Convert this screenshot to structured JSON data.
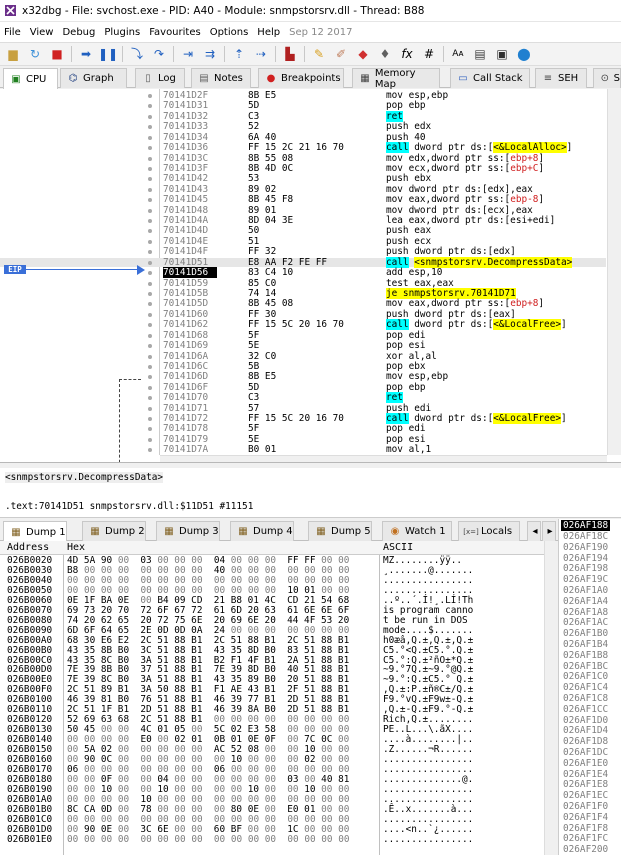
{
  "titlebar": {
    "title": "x32dbg - File: svchost.exe - PID: A40 - Module: snmpstorsrv.dll - Thread: B88"
  },
  "menubar": {
    "items": [
      "File",
      "View",
      "Debug",
      "Plugins",
      "Favourites",
      "Options",
      "Help"
    ],
    "date": "Sep 12 2017"
  },
  "tabs": [
    {
      "label": "CPU",
      "icon": "cpu-icon"
    },
    {
      "label": "Graph",
      "icon": "graph-icon"
    },
    {
      "label": "Log",
      "icon": "log-icon"
    },
    {
      "label": "Notes",
      "icon": "notes-icon"
    },
    {
      "label": "Breakpoints",
      "icon": "breakpoint-icon"
    },
    {
      "label": "Memory Map",
      "icon": "memory-map-icon"
    },
    {
      "label": "Call Stack",
      "icon": "call-stack-icon"
    },
    {
      "label": "SEH",
      "icon": "seh-icon"
    },
    {
      "label": "S",
      "icon": "script-icon"
    }
  ],
  "eip_label": "EIP",
  "disasm": [
    {
      "a": "70141D2F",
      "b": "8B E5",
      "i": "mov esp,ebp"
    },
    {
      "a": "70141D31",
      "b": "5D",
      "i": "pop ebp"
    },
    {
      "a": "70141D32",
      "b": "C3",
      "i": "ret",
      "t": "ret"
    },
    {
      "a": "70141D33",
      "b": "52",
      "i": "push edx"
    },
    {
      "a": "70141D34",
      "b": "6A 40",
      "i": "push 40"
    },
    {
      "a": "70141D36",
      "b": "FF 15 2C 21 16 70",
      "i": "call dword ptr ds:[<&LocalAlloc>]",
      "t": "call"
    },
    {
      "a": "70141D3C",
      "b": "8B 55 08",
      "i": "mov edx,dword ptr ss:[ebp+8]"
    },
    {
      "a": "70141D3F",
      "b": "8B 4D 0C",
      "i": "mov ecx,dword ptr ss:[ebp+C]"
    },
    {
      "a": "70141D42",
      "b": "53",
      "i": "push ebx"
    },
    {
      "a": "70141D43",
      "b": "89 02",
      "i": "mov dword ptr ds:[edx],eax"
    },
    {
      "a": "70141D45",
      "b": "8B 45 F8",
      "i": "mov eax,dword ptr ss:[ebp-8]"
    },
    {
      "a": "70141D48",
      "b": "89 01",
      "i": "mov dword ptr ds:[ecx],eax"
    },
    {
      "a": "70141D4A",
      "b": "8D 04 3E",
      "i": "lea eax,dword ptr ds:[esi+edi]"
    },
    {
      "a": "70141D4D",
      "b": "50",
      "i": "push eax"
    },
    {
      "a": "70141D4E",
      "b": "51",
      "i": "push ecx"
    },
    {
      "a": "70141D4F",
      "b": "FF 32",
      "i": "push dword ptr ds:[edx]"
    },
    {
      "a": "70141D51",
      "b": "E8 AA F2 FE FF",
      "i": "call <snmpstorsrv.DecompressData>",
      "t": "call",
      "hl": true
    },
    {
      "a": "70141D56",
      "b": "83 C4 10",
      "i": "add esp,10",
      "cur": true
    },
    {
      "a": "70141D59",
      "b": "85 C0",
      "i": "test eax,eax"
    },
    {
      "a": "70141D5B",
      "b": "74 14",
      "i": "je snmpstorsrv.70141D71",
      "t": "jmp"
    },
    {
      "a": "70141D5D",
      "b": "8B 45 08",
      "i": "mov eax,dword ptr ss:[ebp+8]"
    },
    {
      "a": "70141D60",
      "b": "FF 30",
      "i": "push dword ptr ds:[eax]"
    },
    {
      "a": "70141D62",
      "b": "FF 15 5C 20 16 70",
      "i": "call dword ptr ds:[<&LocalFree>]",
      "t": "call"
    },
    {
      "a": "70141D68",
      "b": "5F",
      "i": "pop edi"
    },
    {
      "a": "70141D69",
      "b": "5E",
      "i": "pop esi"
    },
    {
      "a": "70141D6A",
      "b": "32 C0",
      "i": "xor al,al"
    },
    {
      "a": "70141D6C",
      "b": "5B",
      "i": "pop ebx"
    },
    {
      "a": "70141D6D",
      "b": "8B E5",
      "i": "mov esp,ebp"
    },
    {
      "a": "70141D6F",
      "b": "5D",
      "i": "pop ebp"
    },
    {
      "a": "70141D70",
      "b": "C3",
      "i": "ret",
      "t": "ret"
    },
    {
      "a": "70141D71",
      "b": "57",
      "i": "push edi"
    },
    {
      "a": "70141D72",
      "b": "FF 15 5C 20 16 70",
      "i": "call dword ptr ds:[<&LocalFree>]",
      "t": "call"
    },
    {
      "a": "70141D78",
      "b": "5F",
      "i": "pop edi"
    },
    {
      "a": "70141D79",
      "b": "5E",
      "i": "pop esi"
    },
    {
      "a": "70141D7A",
      "b": "B0 01",
      "i": "mov al,1"
    }
  ],
  "info": {
    "line1": "<snmpstorsrv.DecompressData>",
    "line2": ".text:70141D51 snmpstorsrv.dll:$11D51 #11151"
  },
  "dump_tabs": [
    {
      "label": "Dump 1",
      "icon": "dump-icon"
    },
    {
      "label": "Dump 2",
      "icon": "dump-icon"
    },
    {
      "label": "Dump 3",
      "icon": "dump-icon"
    },
    {
      "label": "Dump 4",
      "icon": "dump-icon"
    },
    {
      "label": "Dump 5",
      "icon": "dump-icon"
    },
    {
      "label": "Watch 1",
      "icon": "watch-icon"
    },
    {
      "label": "Locals",
      "icon": "locals-icon"
    }
  ],
  "dump_header": {
    "address": "Address",
    "hex": "Hex",
    "ascii": "ASCII"
  },
  "dump": [
    {
      "a": "026B0020",
      "h": "4D 5A 90 00 03 00 00 00 04 00 00 00 FF FF 00 00",
      "x": "MZ........ÿÿ.."
    },
    {
      "a": "026B0030",
      "h": "B8 00 00 00 00 00 00 00 40 00 00 00 00 00 00 00",
      "x": "¸.......@......."
    },
    {
      "a": "026B0040",
      "h": "00 00 00 00 00 00 00 00 00 00 00 00 00 00 00 00",
      "x": "................"
    },
    {
      "a": "026B0050",
      "h": "00 00 00 00 00 00 00 00 00 00 00 00 10 01 00 00",
      "x": "................"
    },
    {
      "a": "026B0060",
      "h": "0E 1F BA 0E 00 B4 09 CD 21 B8 01 4C CD 21 54 68",
      "x": "..º..´.Í!¸.LÍ!Th"
    },
    {
      "a": "026B0070",
      "h": "69 73 20 70 72 6F 67 72 61 6D 20 63 61 6E 6E 6F",
      "x": "is program canno"
    },
    {
      "a": "026B0080",
      "h": "74 20 62 65 20 72 75 6E 20 69 6E 20 44 4F 53 20",
      "x": "t be run in DOS "
    },
    {
      "a": "026B0090",
      "h": "6D 6F 64 65 2E 0D 0D 0A 24 00 00 00 00 00 00 00",
      "x": "mode....$......."
    },
    {
      "a": "026B00A0",
      "h": "68 30 E6 E2 2C 51 88 B1 2C 51 88 B1 2C 51 88 B1",
      "x": "h0æâ,Q.±,Q.±,Q.±"
    },
    {
      "a": "026B00B0",
      "h": "43 35 8B B0 3C 51 88 B1 43 35 8D B0 83 51 88 B1",
      "x": "C5.°<Q.±C5.°.Q.±"
    },
    {
      "a": "026B00C0",
      "h": "43 35 8C B0 3A 51 88 B1 B2 F1 4F B1 2A 51 88 B1",
      "x": "C5.°:Q.±²ñO±*Q.±"
    },
    {
      "a": "026B00D0",
      "h": "7E 39 8B B0 37 51 88 B1 7E 39 8D B0 40 51 88 B1",
      "x": "~9.°7Q.±~9.°@Q.±"
    },
    {
      "a": "026B00E0",
      "h": "7E 39 8C B0 3A 51 88 B1 43 35 89 B0 20 51 88 B1",
      "x": "~9.°:Q.±C5.° Q.±"
    },
    {
      "a": "026B00F0",
      "h": "2C 51 89 B1 3A 50 88 B1 F1 AE 43 B1 2F 51 88 B1",
      "x": ",Q.±:P.±ñ®C±/Q.±"
    },
    {
      "a": "026B0100",
      "h": "46 39 81 B0 76 51 88 B1 46 39 77 B1 2D 51 88 B1",
      "x": "F9.°vQ.±F9w±-Q.±"
    },
    {
      "a": "026B0110",
      "h": "2C 51 1F B1 2D 51 88 B1 46 39 8A B0 2D 51 88 B1",
      "x": ",Q.±-Q.±F9.°-Q.±"
    },
    {
      "a": "026B0120",
      "h": "52 69 63 68 2C 51 88 B1 00 00 00 00 00 00 00 00",
      "x": "Rich,Q.±........"
    },
    {
      "a": "026B0130",
      "h": "50 45 00 00 4C 01 05 00 5C 02 E3 58 00 00 00 00",
      "x": "PE..L...\\.ãX...."
    },
    {
      "a": "026B0140",
      "h": "00 00 00 00 E0 00 02 01 0B 01 0E 0F 00 7C 0C 00",
      "x": "....à........|.."
    },
    {
      "a": "026B0150",
      "h": "00 5A 02 00 00 00 00 00 AC 52 08 00 00 10 00 00",
      "x": ".Z......¬R......"
    },
    {
      "a": "026B0160",
      "h": "00 90 0C 00 00 00 00 00 00 10 00 00 00 02 00 00",
      "x": "................"
    },
    {
      "a": "026B0170",
      "h": "06 00 00 00 00 00 00 00 06 00 00 00 00 00 00 00",
      "x": "................"
    },
    {
      "a": "026B0180",
      "h": "00 00 0F 00 00 04 00 00 00 00 00 00 03 00 40 81",
      "x": "..............@."
    },
    {
      "a": "026B0190",
      "h": "00 00 10 00 00 10 00 00 00 00 10 00 00 10 00 00",
      "x": "................"
    },
    {
      "a": "026B01A0",
      "h": "00 00 00 00 10 00 00 00 00 00 00 00 00 00 00 00",
      "x": "................"
    },
    {
      "a": "026B01B0",
      "h": "8C CA 0D 00 78 00 00 00 00 80 0E 00 E0 01 00 00",
      "x": ".Ê..x.......à..."
    },
    {
      "a": "026B01C0",
      "h": "00 00 00 00 00 00 00 00 00 00 00 00 00 00 00 00",
      "x": "................"
    },
    {
      "a": "026B01D0",
      "h": "00 90 0E 00 3C 6E 00 00 60 BF 00 00 1C 00 00 00",
      "x": "....<n..`¿......"
    },
    {
      "a": "026B01E0",
      "h": "00 00 00 00 00 00 00 00 00 00 00 00 00 00 00 00",
      "x": "................"
    }
  ],
  "stack": {
    "current": "026AF188",
    "rows": [
      "026AF18C",
      "026AF190",
      "026AF194",
      "026AF198",
      "026AF19C",
      "026AF1A0",
      "026AF1A4",
      "026AF1A8",
      "026AF1AC",
      "026AF1B0",
      "026AF1B4",
      "026AF1B8",
      "026AF1BC",
      "026AF1C0",
      "026AF1C4",
      "026AF1C8",
      "026AF1CC",
      "026AF1D0",
      "026AF1D4",
      "026AF1D8",
      "026AF1DC",
      "026AF1E0",
      "026AF1E4",
      "026AF1E8",
      "026AF1EC",
      "026AF1F0",
      "026AF1F4",
      "026AF1F8",
      "026AF1FC",
      "026AF200"
    ]
  },
  "colors": {
    "call": "#00ffff",
    "jump": "#ffff00",
    "eip": "#3a6fd8",
    "address_gray": "#808080"
  }
}
